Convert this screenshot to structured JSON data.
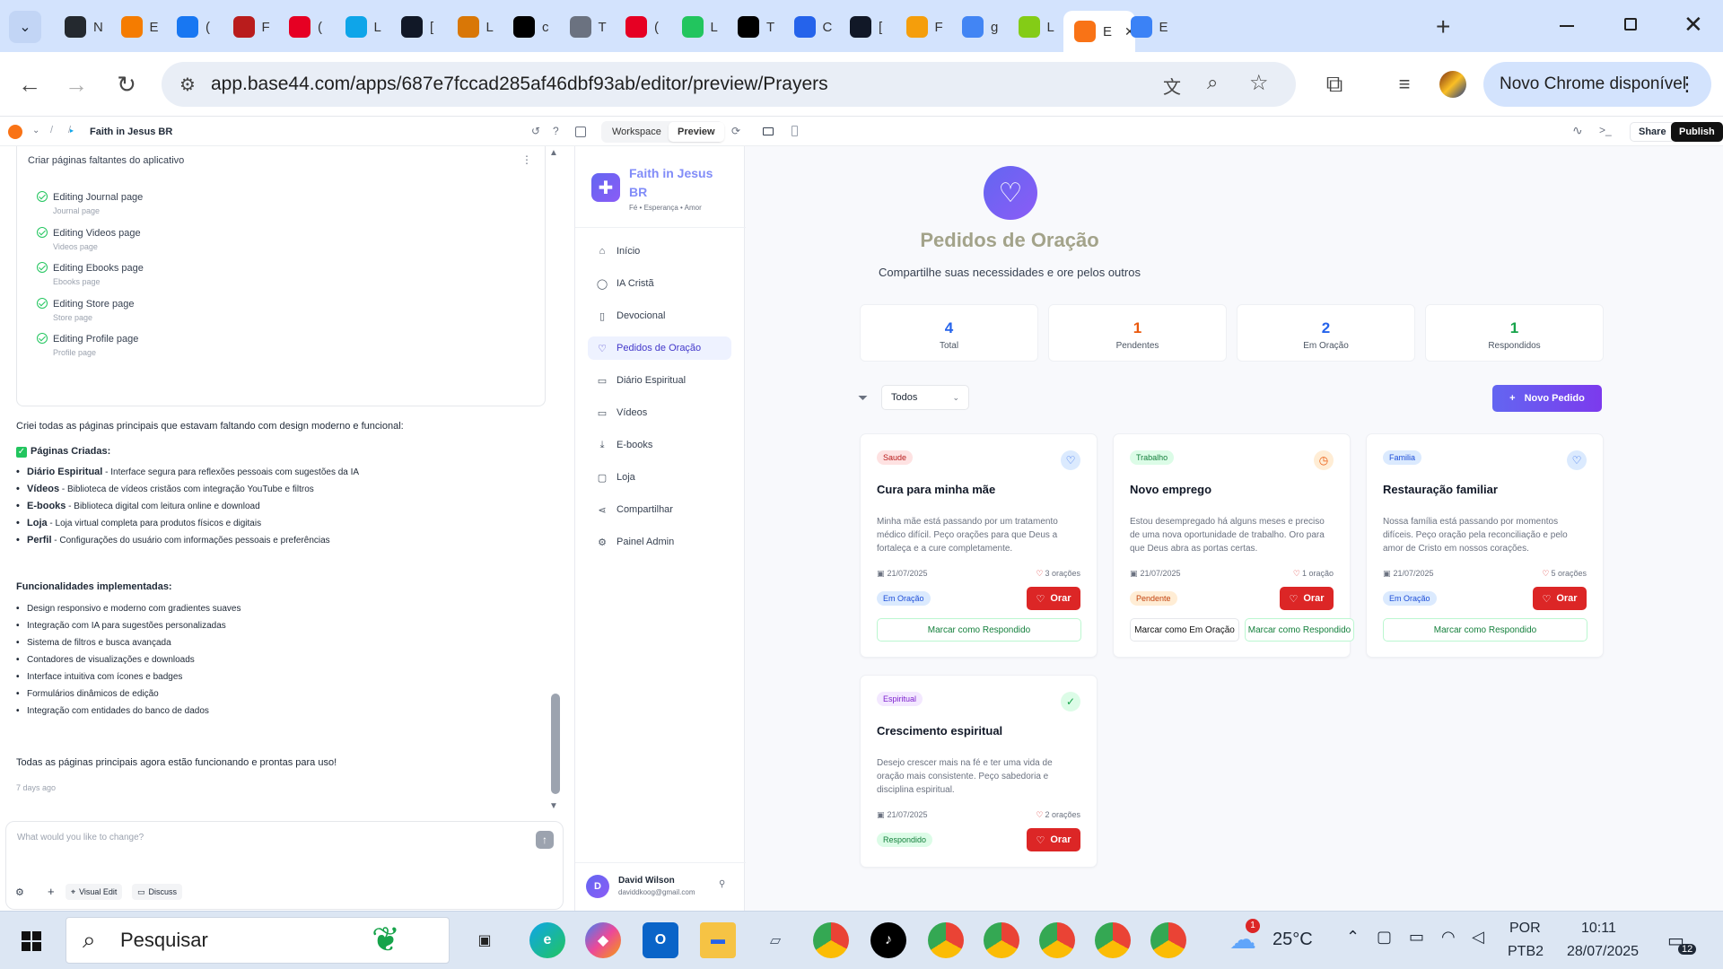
{
  "browser": {
    "tabs": [
      {
        "label": "N",
        "icon": "github-icon",
        "color": "#24292f"
      },
      {
        "label": "E",
        "icon": "blogger-icon",
        "color": "#f57c00"
      },
      {
        "label": "(",
        "icon": "facebook-icon",
        "color": "#1877f2"
      },
      {
        "label": "F",
        "icon": "red-square-icon",
        "color": "#b91c1c"
      },
      {
        "label": "(",
        "icon": "pinterest-icon",
        "color": "#e60023"
      },
      {
        "label": "L",
        "icon": "q-icon",
        "color": "#0ea5e9"
      },
      {
        "label": "[",
        "icon": "dn-ai-icon",
        "color": "#111827"
      },
      {
        "label": "L",
        "icon": "sandwich-icon",
        "color": "#d97706"
      },
      {
        "label": "c",
        "icon": "capcut-icon",
        "color": "#000000"
      },
      {
        "label": "T",
        "icon": "globe-icon",
        "color": "#6b7280"
      },
      {
        "label": "(",
        "icon": "pinterest-icon",
        "color": "#e60023"
      },
      {
        "label": "L",
        "icon": "leaf-icon",
        "color": "#22c55e"
      },
      {
        "label": "T",
        "icon": "tiktok-icon",
        "color": "#000000"
      },
      {
        "label": "C",
        "icon": "c-icon",
        "color": "#2563eb"
      },
      {
        "label": "[",
        "icon": "openai-icon",
        "color": "#111827"
      },
      {
        "label": "F",
        "icon": "bitcoin-icon",
        "color": "#f59e0b"
      },
      {
        "label": "g",
        "icon": "google-icon",
        "color": "#4285f4"
      },
      {
        "label": "L",
        "icon": "l-icon",
        "color": "#84cc16"
      },
      {
        "label": "E",
        "icon": "base44-icon",
        "color": "#f97316",
        "active": true
      },
      {
        "label": "E",
        "icon": "colorful-icon",
        "color": "#3b82f6"
      }
    ],
    "url": "app.base44.com/apps/687e7fccad285af46dbf93ab/editor/preview/Prayers",
    "update_label": "Novo Chrome disponível"
  },
  "appbar": {
    "project": "Faith in Jesus BR",
    "workspace": "Workspace",
    "preview": "Preview",
    "share": "Share",
    "publish": "Publish"
  },
  "chat": {
    "task_title": "Criar páginas faltantes do aplicativo",
    "tasks": [
      {
        "label": "Editing Journal page",
        "sub": "Journal page"
      },
      {
        "label": "Editing Videos page",
        "sub": "Videos page"
      },
      {
        "label": "Editing Ebooks page",
        "sub": "Ebooks page"
      },
      {
        "label": "Editing Store page",
        "sub": "Store page"
      },
      {
        "label": "Editing Profile page",
        "sub": "Profile page"
      }
    ],
    "intro": "Criei todas as páginas principais que estavam faltando com design moderno e funcional:",
    "pages_heading": "Páginas Criadas:",
    "pages": [
      {
        "name": "Diário Espiritual",
        "desc": " - Interface segura para reflexões pessoais com sugestões da IA"
      },
      {
        "name": "Vídeos",
        "desc": " - Biblioteca de vídeos cristãos com integração YouTube e filtros"
      },
      {
        "name": "E-books",
        "desc": " - Biblioteca digital com leitura online e download"
      },
      {
        "name": "Loja",
        "desc": " - Loja virtual completa para produtos físicos e digitais"
      },
      {
        "name": "Perfil",
        "desc": " - Configurações do usuário com informações pessoais e preferências"
      }
    ],
    "features_heading": "Funcionalidades implementadas:",
    "features": [
      "Design responsivo e moderno com gradientes suaves",
      "Integração com IA para sugestões personalizadas",
      "Sistema de filtros e busca avançada",
      "Contadores de visualizações e downloads",
      "Interface intuitiva com ícones e badges",
      "Formulários dinâmicos de edição",
      "Integração com entidades do banco de dados"
    ],
    "closing": "Todas as páginas principais agora estão funcionando e prontas para uso!",
    "time_ago": "7 days ago",
    "input_placeholder": "What would you like to change?",
    "visual_edit": "Visual Edit",
    "discuss": "Discuss"
  },
  "app": {
    "brand": {
      "title_line1": "Faith in Jesus",
      "title_line2": "BR",
      "tagline": "Fé • Esperança • Amor"
    },
    "nav": [
      {
        "label": "Início",
        "icon": "home-icon",
        "glyph": "⌂"
      },
      {
        "label": "IA Cristã",
        "icon": "chat-icon",
        "glyph": "◯"
      },
      {
        "label": "Devocional",
        "icon": "book-icon",
        "glyph": "▯"
      },
      {
        "label": "Pedidos de Oração",
        "icon": "heart-icon",
        "glyph": "♡",
        "active": true
      },
      {
        "label": "Diário Espiritual",
        "icon": "open-book-icon",
        "glyph": "▭"
      },
      {
        "label": "Vídeos",
        "icon": "video-icon",
        "glyph": "▭"
      },
      {
        "label": "E-books",
        "icon": "download-icon",
        "glyph": "⤓"
      },
      {
        "label": "Loja",
        "icon": "bag-icon",
        "glyph": "▢"
      },
      {
        "label": "Compartilhar",
        "icon": "share-icon",
        "glyph": "⋖"
      },
      {
        "label": "Painel Admin",
        "icon": "settings-icon",
        "glyph": "⚙"
      }
    ],
    "user": {
      "initial": "D",
      "name": "David Wilson",
      "email": "daviddkoog@gmail.com"
    },
    "page_title": "Pedidos de Oração",
    "page_subtitle": "Compartilhe suas necessidades e ore pelos outros",
    "stats": [
      {
        "value": "4",
        "label": "Total",
        "color": "#2563eb"
      },
      {
        "value": "1",
        "label": "Pendentes",
        "color": "#ea580c"
      },
      {
        "value": "2",
        "label": "Em Oração",
        "color": "#2563eb"
      },
      {
        "value": "1",
        "label": "Respondidos",
        "color": "#16a34a"
      }
    ],
    "filter_value": "Todos",
    "new_button": "Novo Pedido",
    "cards": [
      {
        "category": "Saude",
        "cat_bg": "#fee2e2",
        "cat_fg": "#b91c1c",
        "title": "Cura para minha mãe",
        "desc": "Minha mãe está passando por um tratamento médico difícil. Peço orações para que Deus a fortaleça e a cure completamente.",
        "date": "21/07/2025",
        "prayers": "3 orações",
        "status": "Em Oração",
        "st_bg": "#dbeafe",
        "st_fg": "#1d4ed8",
        "icon": "heart-icon",
        "icon_glyph": "♡",
        "icon_bg": "#dbeafe",
        "icon_fg": "#2563eb",
        "mark": "Marcar como Respondido",
        "pray": "Orar"
      },
      {
        "category": "Trabalho",
        "cat_bg": "#dcfce7",
        "cat_fg": "#15803d",
        "title": "Novo emprego",
        "desc": "Estou desempregado há alguns meses e preciso de uma nova oportunidade de trabalho. Oro para que Deus abra as portas certas.",
        "date": "21/07/2025",
        "prayers": "1 oração",
        "status": "Pendente",
        "st_bg": "#ffedd5",
        "st_fg": "#c2410c",
        "icon": "clock-icon",
        "icon_glyph": "◷",
        "icon_bg": "#ffedd5",
        "icon_fg": "#ea580c",
        "mark_pray": "Marcar como Em Oração",
        "mark": "Marcar como Respondido",
        "pray": "Orar"
      },
      {
        "category": "Familia",
        "cat_bg": "#dbeafe",
        "cat_fg": "#1d4ed8",
        "title": "Restauração familiar",
        "desc": "Nossa família está passando por momentos difíceis. Peço oração pela reconciliação e pelo amor de Cristo em nossos corações.",
        "date": "21/07/2025",
        "prayers": "5 orações",
        "status": "Em Oração",
        "st_bg": "#dbeafe",
        "st_fg": "#1d4ed8",
        "icon": "heart-icon",
        "icon_glyph": "♡",
        "icon_bg": "#dbeafe",
        "icon_fg": "#2563eb",
        "mark": "Marcar como Respondido",
        "pray": "Orar"
      },
      {
        "category": "Espiritual",
        "cat_bg": "#f3e8ff",
        "cat_fg": "#7e22ce",
        "title": "Crescimento espiritual",
        "desc": "Desejo crescer mais na fé e ter uma vida de oração mais consistente. Peço sabedoria e disciplina espiritual.",
        "date": "21/07/2025",
        "prayers": "2 orações",
        "status": "Respondido",
        "st_bg": "#dcfce7",
        "st_fg": "#15803d",
        "icon": "check-circle-icon",
        "icon_glyph": "✓",
        "icon_bg": "#dcfce7",
        "icon_fg": "#16a34a",
        "pray": "Orar"
      }
    ]
  },
  "taskbar": {
    "search": "Pesquisar",
    "weather": "25°C",
    "weather_badge": "1",
    "lang1": "POR",
    "lang2": "PTB2",
    "time": "10:11",
    "date": "28/07/2025",
    "notif": "12"
  }
}
